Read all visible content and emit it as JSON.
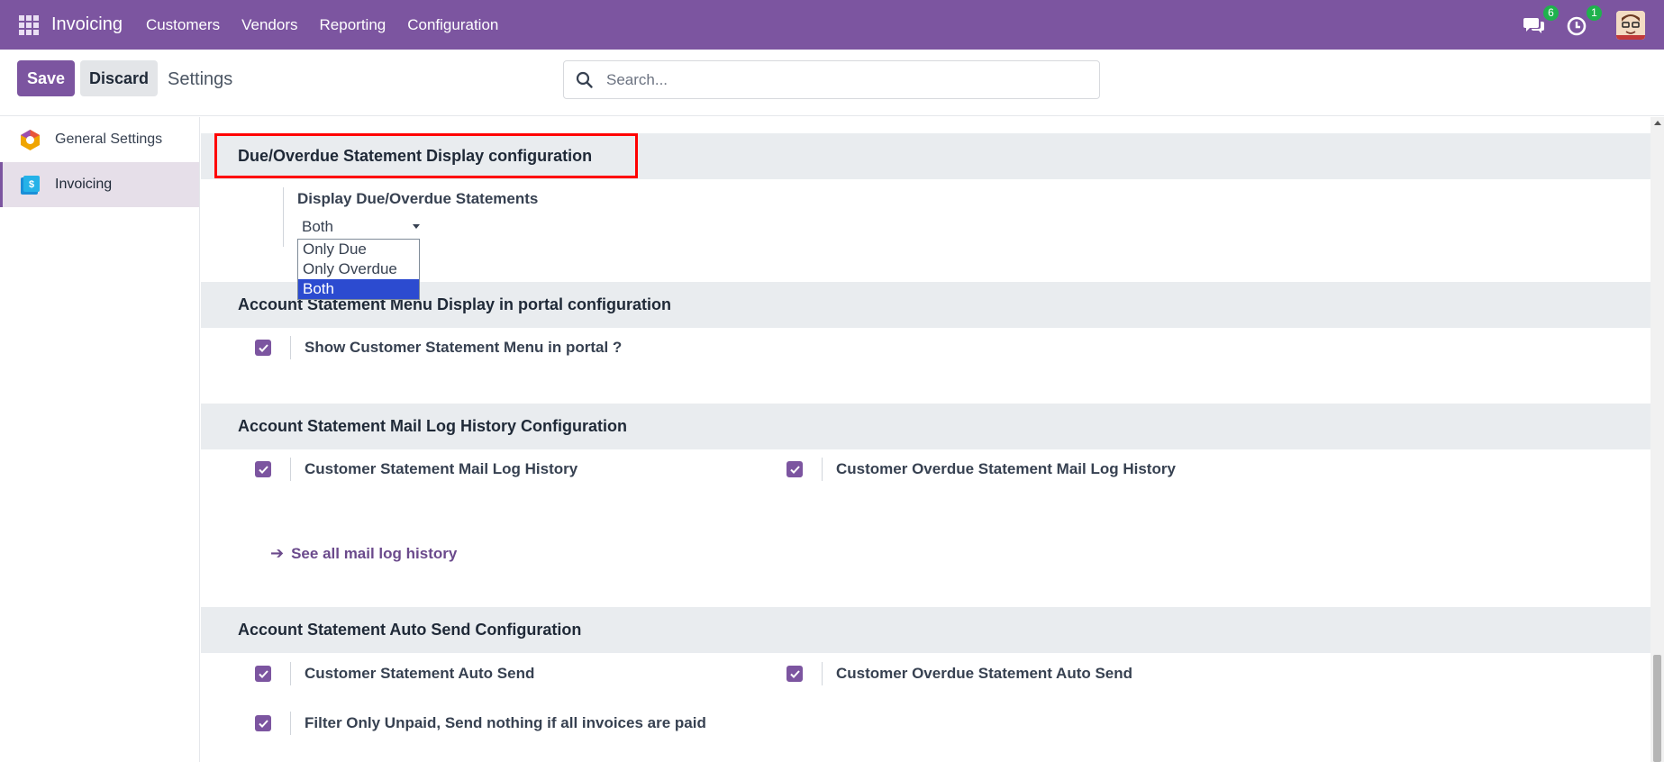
{
  "navbar": {
    "app_name": "Invoicing",
    "menu": [
      "Customers",
      "Vendors",
      "Reporting",
      "Configuration"
    ],
    "messages_badge": "6",
    "activities_badge": "1",
    "accent": "#7c55a0"
  },
  "control": {
    "save_label": "Save",
    "discard_label": "Discard",
    "breadcrumb": "Settings",
    "search_placeholder": "Search..."
  },
  "sidebar": {
    "items": [
      {
        "label": "General Settings",
        "icon": "odoo-logo-icon"
      },
      {
        "label": "Invoicing",
        "icon": "invoicing-app-icon"
      }
    ]
  },
  "sections": {
    "due_overdue": {
      "title": "Due/Overdue Statement Display configuration",
      "field_label": "Display Due/Overdue Statements",
      "selected_value": "Both",
      "options": [
        "Only Due",
        "Only Overdue",
        "Both"
      ]
    },
    "portal_menu": {
      "title": "Account Statement Menu Display in portal configuration",
      "show_menu_label": "Show Customer Statement Menu in portal ?"
    },
    "mail_log": {
      "title": "Account Statement Mail Log History Configuration",
      "customer_log_label": "Customer Statement Mail Log History",
      "overdue_log_label": "Customer Overdue Statement Mail Log History",
      "link_label": "See all mail log history"
    },
    "auto_send": {
      "title": "Account Statement Auto Send Configuration",
      "customer_send_label": "Customer Statement Auto Send",
      "overdue_send_label": "Customer Overdue Statement Auto Send",
      "filter_unpaid_label": "Filter Only Unpaid, Send nothing if all invoices are paid"
    }
  }
}
